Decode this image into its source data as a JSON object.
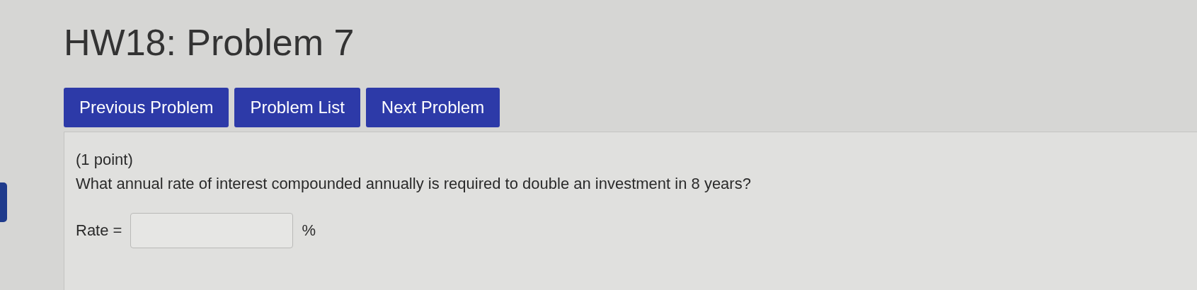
{
  "title": "HW18: Problem 7",
  "nav_buttons": [
    {
      "label": "Previous Problem"
    },
    {
      "label": "Problem List"
    },
    {
      "label": "Next Problem"
    }
  ],
  "problem": {
    "points": "(1 point)",
    "question": "What annual rate of interest compounded annually is required to double an investment in 8 years?",
    "answer_label": "Rate =",
    "answer_unit": "%"
  }
}
